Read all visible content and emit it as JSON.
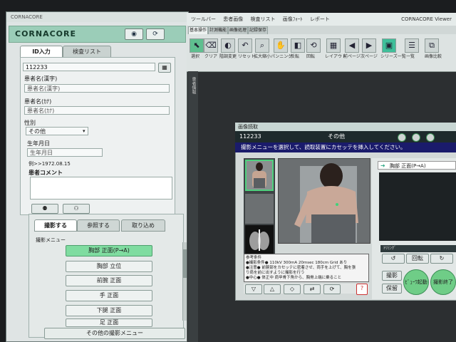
{
  "left_app": {
    "brand": "CORNACORE",
    "tabs": [
      "ID入力",
      "検査リスト"
    ],
    "id_value": "112233",
    "labels": {
      "name_kanji": "患者名(漢字)",
      "name_kana": "患者名(ｶﾅ)",
      "gender": "性別",
      "birthdate": "生年月日",
      "example": "例>>1972.08.15",
      "comment": "患者コメント"
    },
    "placeholders": {
      "name_kanji": "患者名(漢字)",
      "name_kana": "患者名(ｶﾅ)",
      "birthdate": "生年月日"
    },
    "gender_value": "その他",
    "shoot_tabs": [
      "撮影する",
      "参照する",
      "取り込め"
    ],
    "menu_title": "撮影メニュー",
    "menu_items": [
      "胸部 正面(P→A)",
      "胸部 立位",
      "前腕 正面",
      "手 正面",
      "下腿 正面",
      "足 正面"
    ],
    "other_menu": "その他の撮影メニュー"
  },
  "viewer": {
    "title": "CORNACORE Viewer",
    "top_checks": [
      "ツールバー",
      "患者画像",
      "検査リスト",
      "画像ﾌｫｰﾄ",
      "レポート"
    ],
    "tabs": [
      "基本操作",
      "計測機能",
      "画像処理",
      "記録保存"
    ],
    "tools": [
      "選択",
      "クリア",
      "階調変更",
      "リセット",
      "拡大縮小",
      "パンニング",
      "反転",
      "回転",
      "レイアウト",
      "前ページ",
      "次ページ",
      "シリーズ一覧",
      "一覧",
      "画像比較"
    ],
    "side_label": "患者情報"
  },
  "dialog": {
    "title": "画像読取",
    "patient_id": "112233",
    "category": "その他",
    "instruction": "撮影メニューを選択して、読取装置にカセッテを挿入してください。",
    "current_menu": "胸部 正面(P→A)",
    "conditions_title": "参考条件",
    "conditions": [
      "●撮影条件● 110kV 300mA 20msec 180cm Grid あり",
      "●注意● 前腕部をカセッテに密着させ、両手を上げて、胸を張",
      "り肩を前に出すように撮影を行う",
      "●中心● 体正中 肩甲骨下角から、胸骨上端に乗ること"
    ],
    "right_labels": [
      "ﾄﾘﾐﾝｸﾞ",
      "回転",
      "撮影",
      "保留"
    ],
    "start_label": "ﾋﾞｭｰﾜ起動",
    "end_label": "撮影終了"
  }
}
